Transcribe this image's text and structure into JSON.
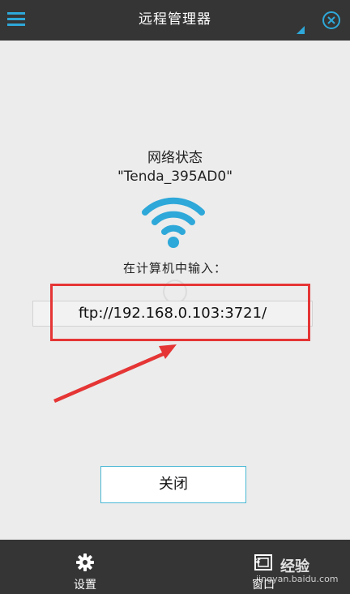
{
  "topbar": {
    "title": "远程管理器",
    "menu_icon": "menu-icon",
    "close_icon": "close-circle-icon"
  },
  "content": {
    "status_label": "网络状态",
    "network_name": "\"Tenda_395AD0\"",
    "wifi_icon": "wifi-icon",
    "prompt_label": "在计算机中输入：",
    "address": "ftp://192.168.0.103:3721/",
    "close_button_label": "关闭"
  },
  "bottombar": {
    "settings_label": "设置",
    "settings_icon": "gear-icon",
    "window_label": "窗口",
    "window_icon": "window-icon"
  },
  "watermark": {
    "text": "经验",
    "url": "jingyan.baidu.com"
  },
  "colors": {
    "bar_background": "#353535",
    "content_background": "#ececec",
    "accent_blue": "#2ea8d9",
    "annotation_red": "#e53535"
  }
}
